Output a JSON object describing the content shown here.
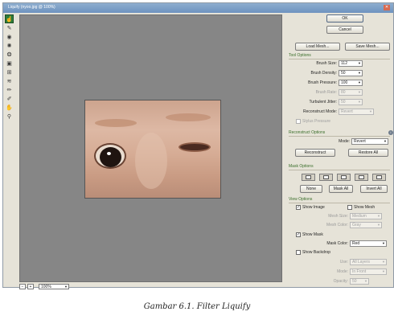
{
  "window": {
    "title": "Liquify (nyoo.jpg @ 100%)",
    "close_glyph": "✕"
  },
  "toolbar": {
    "tools": [
      {
        "name": "forward-warp-tool-icon",
        "glyph": "☝",
        "active": true
      },
      {
        "name": "reconstruct-tool-icon",
        "glyph": "✎",
        "active": false
      },
      {
        "name": "twirl-tool-icon",
        "glyph": "◉",
        "active": false
      },
      {
        "name": "pucker-tool-icon",
        "glyph": "✺",
        "active": false
      },
      {
        "name": "bloat-tool-icon",
        "glyph": "❂",
        "active": false
      },
      {
        "name": "push-left-tool-icon",
        "glyph": "▣",
        "active": false
      },
      {
        "name": "mirror-tool-icon",
        "glyph": "⊞",
        "active": false
      },
      {
        "name": "turbulence-tool-icon",
        "glyph": "≋",
        "active": false
      },
      {
        "name": "freeze-mask-tool-icon",
        "glyph": "✏",
        "active": false
      },
      {
        "name": "thaw-mask-tool-icon",
        "glyph": "✐",
        "active": false
      },
      {
        "name": "hand-tool-icon",
        "glyph": "✋",
        "active": false
      },
      {
        "name": "zoom-tool-icon",
        "glyph": "⚲",
        "active": false
      }
    ]
  },
  "statusbar": {
    "zoom_out": "−",
    "zoom_in": "+",
    "zoom_value": "100%",
    "zoom_arrow": "▼"
  },
  "buttons": {
    "ok": "OK",
    "cancel": "Cancel",
    "load_mesh": "Load Mesh...",
    "save_mesh": "Save Mesh...",
    "reconstruct": "Reconstruct",
    "restore_all": "Restore All",
    "none": "None",
    "mask_all": "Mask All",
    "invert_all": "Invert All"
  },
  "tool_options": {
    "heading": "Tool Options",
    "brush_size_label": "Brush Size:",
    "brush_size": "112",
    "brush_density_label": "Brush Density:",
    "brush_density": "50",
    "brush_pressure_label": "Brush Pressure:",
    "brush_pressure": "100",
    "brush_rate_label": "Brush Rate:",
    "brush_rate": "80",
    "turbulent_jitter_label": "Turbulent Jitter:",
    "turbulent_jitter": "50",
    "reconstruct_mode_label": "Reconstruct Mode:",
    "reconstruct_mode": "Revert",
    "stylus_pressure": "Stylus Pressure"
  },
  "reconstruct_options": {
    "heading": "Reconstruct Options",
    "mode_label": "Mode:",
    "mode": "Revert"
  },
  "mask_options": {
    "heading": "Mask Options"
  },
  "view_options": {
    "heading": "View Options",
    "show_image": "Show Image",
    "show_image_checked": true,
    "show_mesh": "Show Mesh",
    "show_mesh_checked": false,
    "mesh_size_label": "Mesh Size:",
    "mesh_size": "Medium",
    "mesh_color_label": "Mesh Color:",
    "mesh_color": "Gray",
    "show_mask": "Show Mask",
    "show_mask_checked": true,
    "mask_color_label": "Mask Color:",
    "mask_color": "Red",
    "show_backdrop": "Show Backdrop",
    "show_backdrop_checked": false,
    "use_label": "Use:",
    "use": "All Layers",
    "mode_label": "Mode:",
    "mode": "In Front",
    "opacity_label": "Opacity:",
    "opacity": "50"
  },
  "caption": "Gambar 6.1. Filter Liquify",
  "colors": {
    "canvas": "#868686",
    "panel": "#e6e3d8",
    "section_heading": "#3a6e2a",
    "active_tool": "#2f7d3a"
  }
}
